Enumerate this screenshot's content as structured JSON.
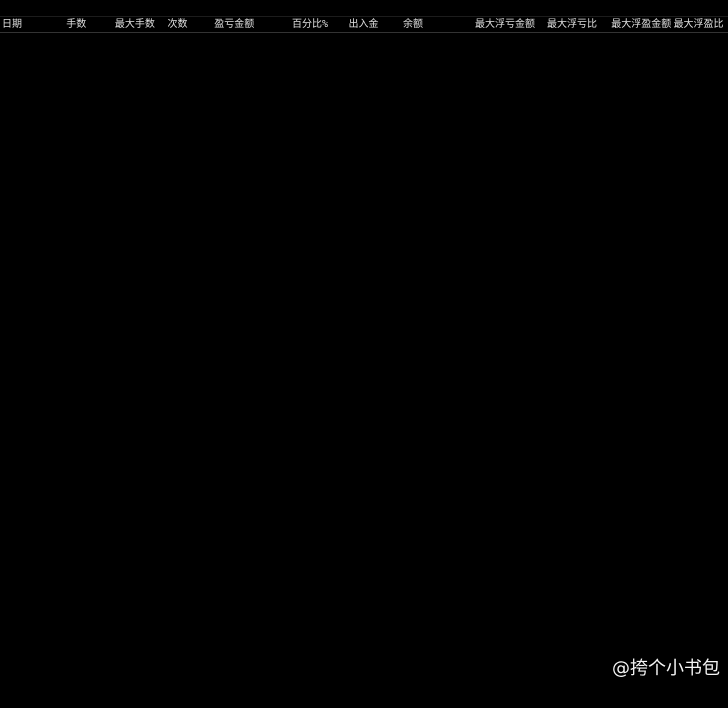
{
  "tabs": [],
  "header": [
    "日期",
    "手数",
    "最大手数",
    "次数",
    "盈亏金额",
    "百分比%",
    "出入金",
    "余额",
    "最大浮亏金额",
    "最大浮亏比",
    "最大浮盈金额",
    "最大浮盈比"
  ],
  "rows": [],
  "summary": [],
  "watermark": "@挎个小书包"
}
